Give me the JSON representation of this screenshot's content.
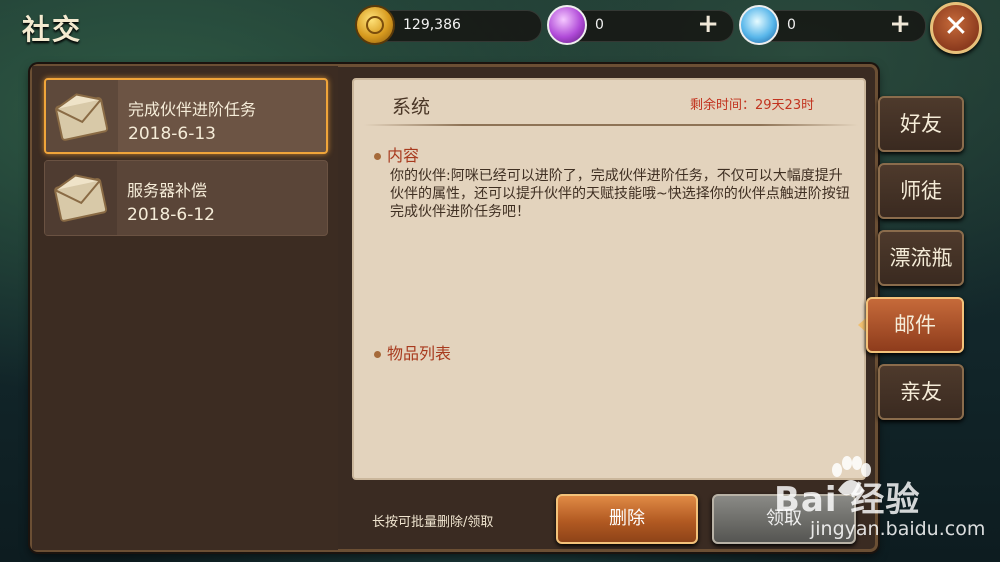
{
  "header": {
    "title": "社交"
  },
  "resources": [
    {
      "icon": "gold-coin-icon",
      "value": "129,386",
      "plus": false
    },
    {
      "icon": "purple-orb-icon",
      "value": "0",
      "plus": true
    },
    {
      "icon": "diamond-icon",
      "value": "0",
      "plus": true
    }
  ],
  "close_label": "✕",
  "mail_list": [
    {
      "title": "完成伙伴进阶任务",
      "date": "2018-6-13",
      "selected": true
    },
    {
      "title": "服务器补偿",
      "date": "2018-6-12",
      "selected": false
    }
  ],
  "detail": {
    "sender": "系统",
    "expire": "剩余时间：29天23时",
    "content_heading": "内容",
    "content_text": "你的伙伴:阿咪已经可以进阶了，完成伙伴进阶任务，不仅可以大幅度提升伙伴的属性，还可以提升伙伴的天赋技能哦~快选择你的伙伴点触进阶按钮完成伙伴进阶任务吧！",
    "items_heading": "物品列表"
  },
  "footer": {
    "hint": "长按可批量删除/领取",
    "delete_label": "删除",
    "claim_label": "领取"
  },
  "tabs": [
    {
      "label": "好友",
      "active": false
    },
    {
      "label": "师徒",
      "active": false
    },
    {
      "label": "漂流瓶",
      "active": false
    },
    {
      "label": "邮件",
      "active": true
    },
    {
      "label": "亲友",
      "active": false
    }
  ],
  "watermark": {
    "text": "Bai 经验",
    "url": "jingyan.baidu.com"
  }
}
